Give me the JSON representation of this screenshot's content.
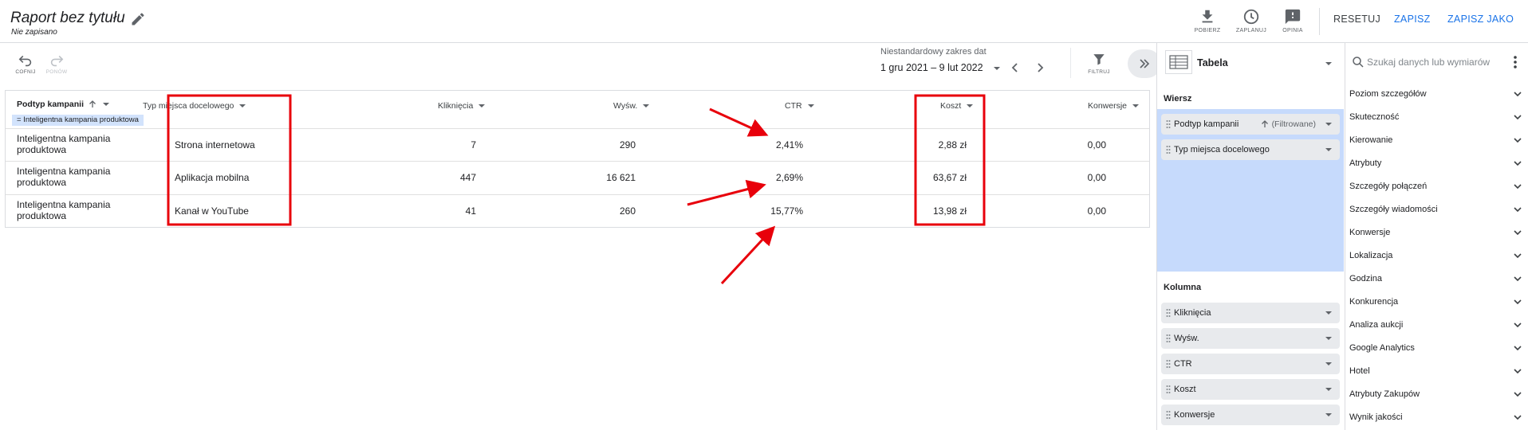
{
  "header": {
    "title": "Raport bez tytułu",
    "subtitle": "Nie zapisano",
    "download_label": "POBIERZ",
    "schedule_label": "ZAPLANUJ",
    "feedback_label": "OPINIA",
    "reset_label": "RESETUJ",
    "save_label": "ZAPISZ",
    "save_as_label": "ZAPISZ JAKO"
  },
  "toolbar": {
    "undo_label": "COFNIJ",
    "redo_label": "PONÓW",
    "date_range_label": "Niestandardowy zakres dat",
    "date_range_value": "1 gru 2021 – 9 lut 2022",
    "filter_label": "FILTRUJ"
  },
  "table": {
    "columns": [
      {
        "label": "Podtyp kampanii",
        "align": "left"
      },
      {
        "label": "Typ miejsca docelowego",
        "align": "left"
      },
      {
        "label": "Kliknięcia",
        "align": "right"
      },
      {
        "label": "Wyśw.",
        "align": "right"
      },
      {
        "label": "CTR",
        "align": "right"
      },
      {
        "label": "Koszt",
        "align": "right"
      },
      {
        "label": "Konwersje",
        "align": "right"
      }
    ],
    "filter_chip": "= Inteligentna kampania produktowa",
    "rows": [
      {
        "subtype": "Inteligentna kampania produktowa",
        "placement": "Strona internetowa",
        "clicks": "7",
        "impressions": "290",
        "ctr": "2,41%",
        "cost": "2,88 zł",
        "conversions": "0,00"
      },
      {
        "subtype": "Inteligentna kampania produktowa",
        "placement": "Aplikacja mobilna",
        "clicks": "447",
        "impressions": "16 621",
        "ctr": "2,69%",
        "cost": "63,67 zł",
        "conversions": "0,00"
      },
      {
        "subtype": "Inteligentna kampania produktowa",
        "placement": "Kanał w YouTube",
        "clicks": "41",
        "impressions": "260",
        "ctr": "15,77%",
        "cost": "13,98 zł",
        "conversions": "0,00"
      }
    ]
  },
  "config": {
    "visualization": "Tabela",
    "row_section": "Wiersz",
    "row_dimensions": [
      {
        "name": "Podtyp kampanii",
        "sort": "(Filtrowane)"
      },
      {
        "name": "Typ miejsca docelowego",
        "sort": ""
      }
    ],
    "column_section": "Kolumna",
    "column_metrics": [
      "Kliknięcia",
      "Wyśw.",
      "CTR",
      "Koszt",
      "Konwersje"
    ]
  },
  "dimensions_panel": {
    "search_placeholder": "Szukaj danych lub wymiarów",
    "categories": [
      "Poziom szczegółów",
      "Skuteczność",
      "Kierowanie",
      "Atrybuty",
      "Szczegóły połączeń",
      "Szczegóły wiadomości",
      "Konwersje",
      "Lokalizacja",
      "Godzina",
      "Konkurencja",
      "Analiza aukcji",
      "Google Analytics",
      "Hotel",
      "Atrybuty Zakupów",
      "Wynik jakości"
    ]
  },
  "colors": {
    "accent": "#1a73e8",
    "annotation": "#e8000b",
    "row_zone": "#c6dafc",
    "chip": "#d2e3fc"
  },
  "icons": [
    "edit-icon",
    "download-icon",
    "schedule-icon",
    "feedback-icon",
    "undo-icon",
    "redo-icon",
    "filter-icon",
    "search-icon",
    "more-vert-icon"
  ]
}
